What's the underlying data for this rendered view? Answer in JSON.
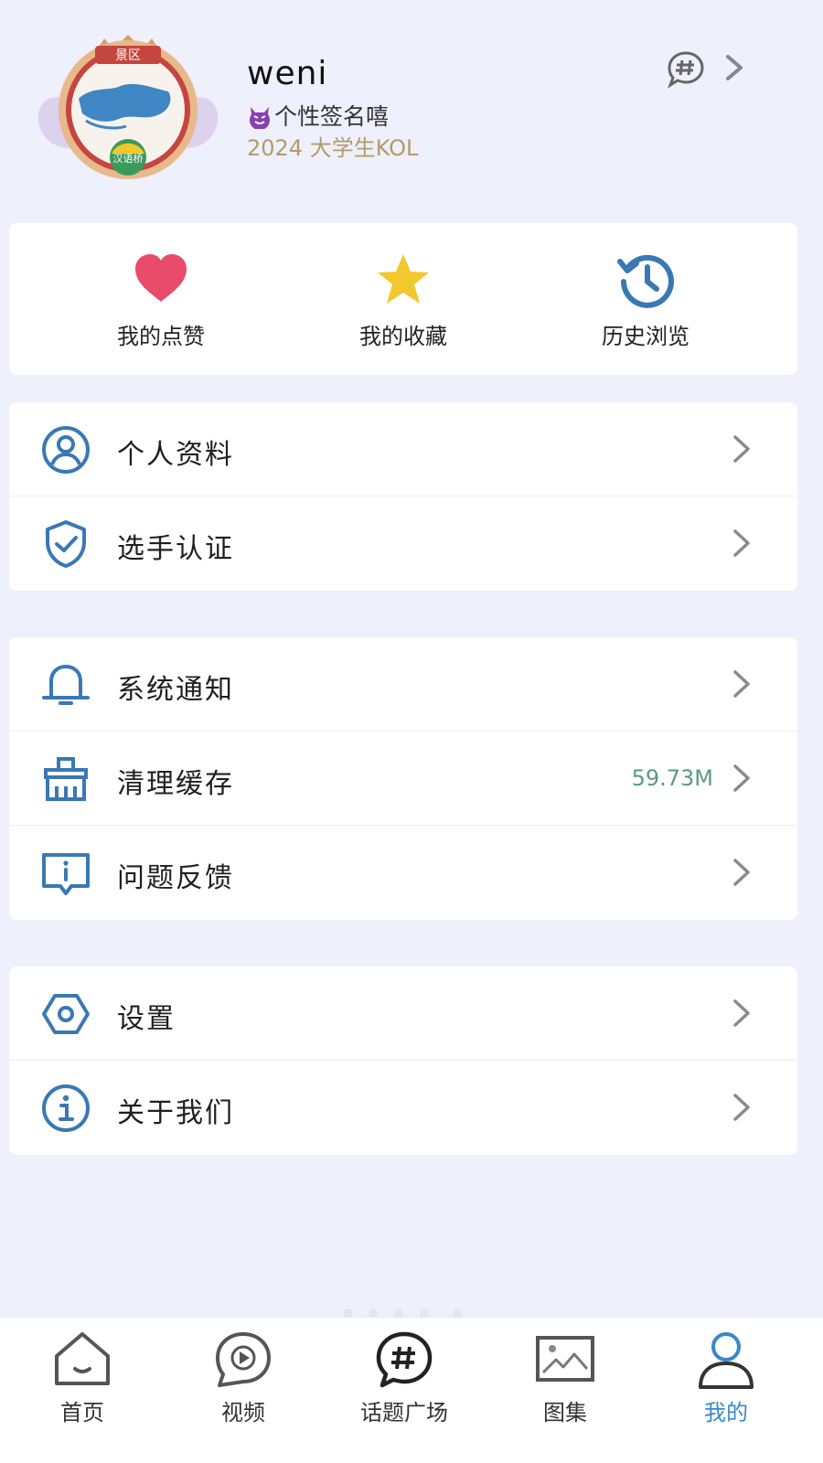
{
  "profile": {
    "username": "weni",
    "signature": "个性签名嘻",
    "tagline": "2024 大学生KOL",
    "avatar_badge_text": "汉语桥",
    "avatar_banner_text": "景区"
  },
  "quick_actions": [
    {
      "label": "我的点赞",
      "icon": "heart-icon"
    },
    {
      "label": "我的收藏",
      "icon": "star-icon"
    },
    {
      "label": "历史浏览",
      "icon": "history-icon"
    }
  ],
  "menu_groups": [
    [
      {
        "label": "个人资料",
        "icon": "user-circle-icon"
      },
      {
        "label": "选手认证",
        "icon": "shield-check-icon"
      }
    ],
    [
      {
        "label": "系统通知",
        "icon": "bell-icon"
      },
      {
        "label": "清理缓存",
        "icon": "broom-icon",
        "value": "59.73M"
      },
      {
        "label": "问题反馈",
        "icon": "feedback-icon"
      }
    ],
    [
      {
        "label": "设置",
        "icon": "settings-icon"
      },
      {
        "label": "关于我们",
        "icon": "info-icon"
      }
    ]
  ],
  "bottom_nav": [
    {
      "label": "首页",
      "icon": "home-icon",
      "active": false
    },
    {
      "label": "视频",
      "icon": "video-icon",
      "active": false
    },
    {
      "label": "话题广场",
      "icon": "topic-icon",
      "active": false
    },
    {
      "label": "图集",
      "icon": "gallery-icon",
      "active": false
    },
    {
      "label": "我的",
      "icon": "user-icon",
      "active": true
    }
  ],
  "colors": {
    "background": "#eef0fb",
    "icon_blue": "#3a78b4",
    "heart": "#e84c6a",
    "star": "#f3c82c",
    "tagline": "#b49a6a",
    "cache_value": "#5a9a84",
    "active_nav": "#3a88c8"
  }
}
